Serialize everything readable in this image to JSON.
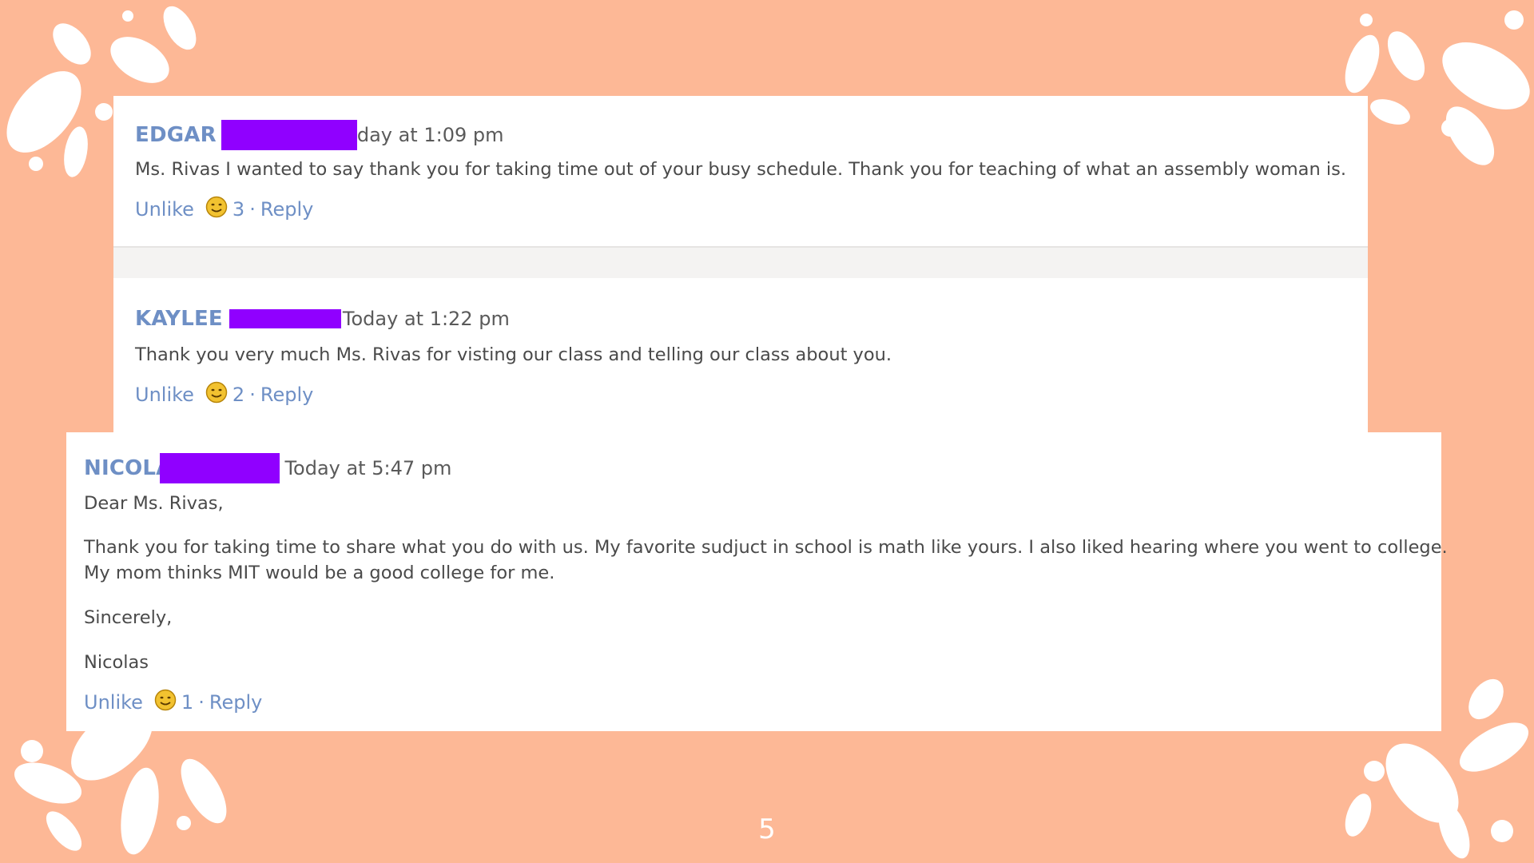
{
  "theme": {
    "background": "#FDB896",
    "card": "#FFFFFF",
    "accent": "#6E8FC5",
    "redaction": "#9000FF"
  },
  "comments": [
    {
      "author": "EDGAR",
      "time": "day at 1:09 pm",
      "body": [
        "Ms. Rivas I wanted to say thank you for taking time out of your busy schedule. Thank you for teaching of what an assembly woman is."
      ],
      "unlike": "Unlike",
      "count": "3",
      "sep": "·",
      "reply": "Reply"
    },
    {
      "author": "KAYLEE",
      "time": "Today at 1:22 pm",
      "body": [
        "Thank you very much Ms. Rivas for visting our class and telling our class about you."
      ],
      "unlike": "Unlike",
      "count": "2",
      "sep": "·",
      "reply": "Reply"
    },
    {
      "author": "NICOLAS",
      "time": "Today at 5:47 pm",
      "body": [
        "Dear Ms. Rivas,",
        "Thank you for taking time to share what you do with us. My favorite sudjuct in school is math like yours. I also liked hearing where you went to college.",
        "My mom thinks MIT would be a good college for me.",
        "Sincerely,",
        "Nicolas"
      ],
      "unlike": "Unlike",
      "count": "1",
      "sep": "·",
      "reply": "Reply"
    }
  ],
  "page_number": "5",
  "icons": {
    "reaction": "smiley-face-icon",
    "decoration": "water-splash-decoration"
  }
}
